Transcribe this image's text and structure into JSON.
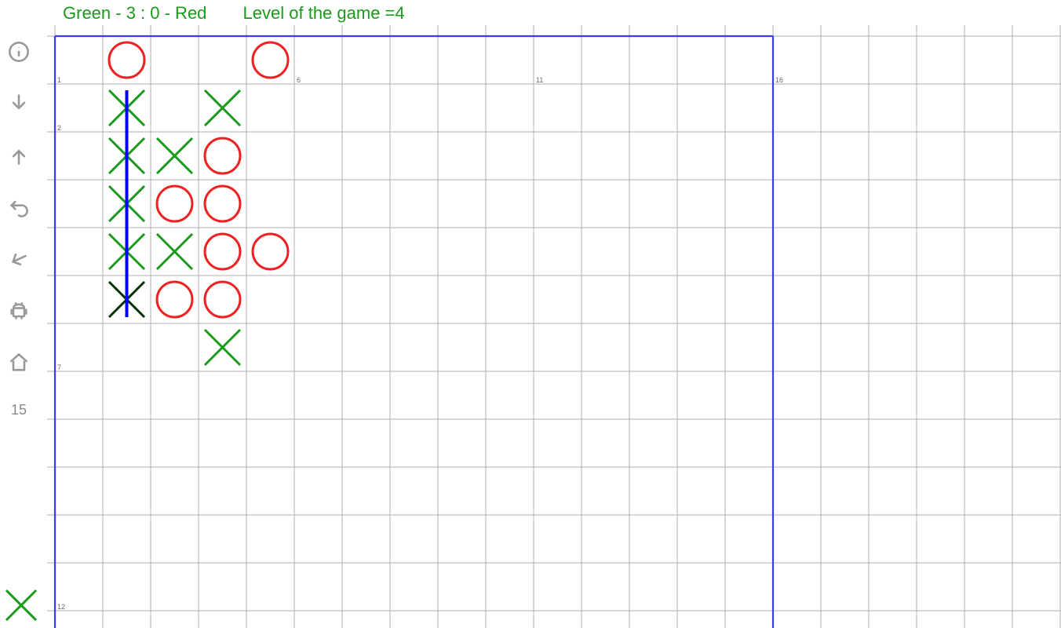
{
  "status": {
    "score_text": "Green - 3  :  0 - Red",
    "level_text": "Level of the game =4"
  },
  "board": {
    "cell_size": 61,
    "cols_total": 22,
    "rows_total": 13,
    "play_cols": 15,
    "play_rows": 15,
    "col_markers": [
      {
        "col": 0,
        "label": "1"
      },
      {
        "col": 5,
        "label": "6"
      },
      {
        "col": 10,
        "label": "11"
      },
      {
        "col": 15,
        "label": "16"
      }
    ],
    "row_markers": [
      {
        "row": 1,
        "label": "2"
      },
      {
        "row": 6,
        "label": "7"
      },
      {
        "row": 11,
        "label": "12"
      }
    ],
    "colors": {
      "x": "#1a9a1a",
      "o": "#e22",
      "x_last": "#003300"
    },
    "pieces": [
      {
        "type": "O",
        "col": 1,
        "row": 0
      },
      {
        "type": "O",
        "col": 4,
        "row": 0
      },
      {
        "type": "X",
        "col": 1,
        "row": 1
      },
      {
        "type": "X",
        "col": 3,
        "row": 1
      },
      {
        "type": "X",
        "col": 1,
        "row": 2
      },
      {
        "type": "X",
        "col": 2,
        "row": 2
      },
      {
        "type": "O",
        "col": 3,
        "row": 2
      },
      {
        "type": "X",
        "col": 1,
        "row": 3
      },
      {
        "type": "O",
        "col": 2,
        "row": 3
      },
      {
        "type": "O",
        "col": 3,
        "row": 3
      },
      {
        "type": "X",
        "col": 1,
        "row": 4
      },
      {
        "type": "X",
        "col": 2,
        "row": 4
      },
      {
        "type": "O",
        "col": 3,
        "row": 4
      },
      {
        "type": "O",
        "col": 4,
        "row": 4
      },
      {
        "type": "X",
        "col": 1,
        "row": 5,
        "last": true
      },
      {
        "type": "O",
        "col": 2,
        "row": 5
      },
      {
        "type": "O",
        "col": 3,
        "row": 5
      },
      {
        "type": "X",
        "col": 3,
        "row": 6
      }
    ],
    "win_line": {
      "col": 1,
      "row_start": 1,
      "row_end": 5
    }
  },
  "sidebar": {
    "size_label": "15"
  },
  "turn": "X"
}
